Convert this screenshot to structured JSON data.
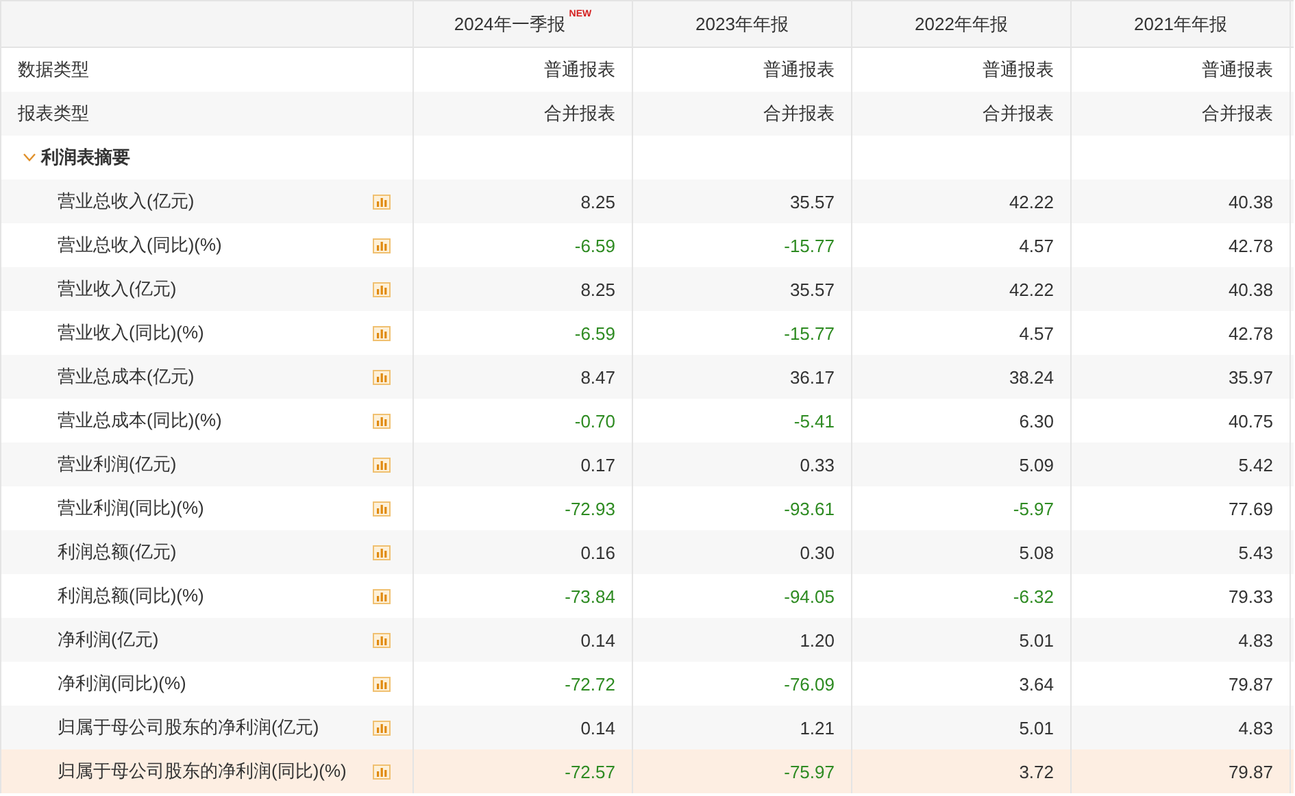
{
  "columns": [
    {
      "title": "2024年一季报",
      "badge": "NEW"
    },
    {
      "title": "2023年年报"
    },
    {
      "title": "2022年年报"
    },
    {
      "title": "2021年年报"
    }
  ],
  "meta_rows": [
    {
      "label": "数据类型",
      "values": [
        "普通报表",
        "普通报表",
        "普通报表",
        "普通报表"
      ]
    },
    {
      "label": "报表类型",
      "values": [
        "合并报表",
        "合并报表",
        "合并报表",
        "合并报表"
      ]
    }
  ],
  "section": {
    "title": "利润表摘要",
    "expanded": true,
    "rows": [
      {
        "label": "营业总收入(亿元)",
        "values": [
          "8.25",
          "35.57",
          "42.22",
          "40.38"
        ],
        "highlighted": false
      },
      {
        "label": "营业总收入(同比)(%)",
        "values": [
          "-6.59",
          "-15.77",
          "4.57",
          "42.78"
        ],
        "highlighted": false
      },
      {
        "label": "营业收入(亿元)",
        "values": [
          "8.25",
          "35.57",
          "42.22",
          "40.38"
        ],
        "highlighted": false
      },
      {
        "label": "营业收入(同比)(%)",
        "values": [
          "-6.59",
          "-15.77",
          "4.57",
          "42.78"
        ],
        "highlighted": false
      },
      {
        "label": "营业总成本(亿元)",
        "values": [
          "8.47",
          "36.17",
          "38.24",
          "35.97"
        ],
        "highlighted": false
      },
      {
        "label": "营业总成本(同比)(%)",
        "values": [
          "-0.70",
          "-5.41",
          "6.30",
          "40.75"
        ],
        "highlighted": false
      },
      {
        "label": "营业利润(亿元)",
        "values": [
          "0.17",
          "0.33",
          "5.09",
          "5.42"
        ],
        "highlighted": false
      },
      {
        "label": "营业利润(同比)(%)",
        "values": [
          "-72.93",
          "-93.61",
          "-5.97",
          "77.69"
        ],
        "highlighted": false
      },
      {
        "label": "利润总额(亿元)",
        "values": [
          "0.16",
          "0.30",
          "5.08",
          "5.43"
        ],
        "highlighted": false
      },
      {
        "label": "利润总额(同比)(%)",
        "values": [
          "-73.84",
          "-94.05",
          "-6.32",
          "79.33"
        ],
        "highlighted": false
      },
      {
        "label": "净利润(亿元)",
        "values": [
          "0.14",
          "1.20",
          "5.01",
          "4.83"
        ],
        "highlighted": false
      },
      {
        "label": "净利润(同比)(%)",
        "values": [
          "-72.72",
          "-76.09",
          "3.64",
          "79.87"
        ],
        "highlighted": false
      },
      {
        "label": "归属于母公司股东的净利润(亿元)",
        "values": [
          "0.14",
          "1.21",
          "5.01",
          "4.83"
        ],
        "highlighted": false
      },
      {
        "label": "归属于母公司股东的净利润(同比)(%)",
        "values": [
          "-72.57",
          "-75.97",
          "3.72",
          "79.87"
        ],
        "highlighted": true
      }
    ]
  }
}
